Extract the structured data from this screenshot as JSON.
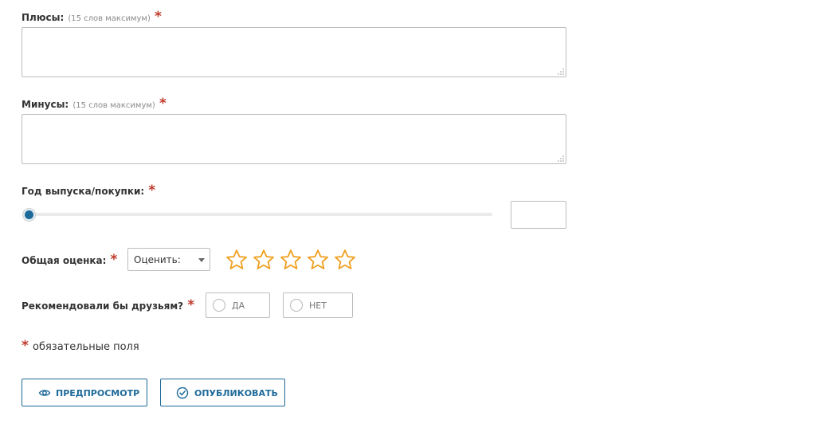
{
  "pros": {
    "label": "Плюсы:",
    "hint": "(15 слов максимум)",
    "required": "*",
    "value": ""
  },
  "cons": {
    "label": "Минусы:",
    "hint": "(15 слов максимум)",
    "required": "*",
    "value": ""
  },
  "year": {
    "label": "Год выпуска/покупки:",
    "required": "*",
    "slider_level": 0,
    "value": ""
  },
  "rating": {
    "label": "Общая оценка:",
    "required": "*",
    "select_value": "Оценить:",
    "stars_total": 5,
    "stars_filled": 0,
    "star_color": "#f0a020"
  },
  "recommend": {
    "label": "Рекомендовали бы друзьям?",
    "required": "*",
    "yes_label": "ДА",
    "no_label": "НЕТ"
  },
  "required_note": {
    "mark": "*",
    "text": "обязательные поля"
  },
  "buttons": {
    "preview_label": "ПРЕДПРОСМОТР",
    "publish_label": "ОПУБЛИКОВАТЬ"
  },
  "colors": {
    "accent": "#1e6a9a",
    "required": "#c0392b"
  },
  "icons": {
    "preview": "eye-icon",
    "publish": "check-circle-icon",
    "star": "star-outline-icon"
  }
}
